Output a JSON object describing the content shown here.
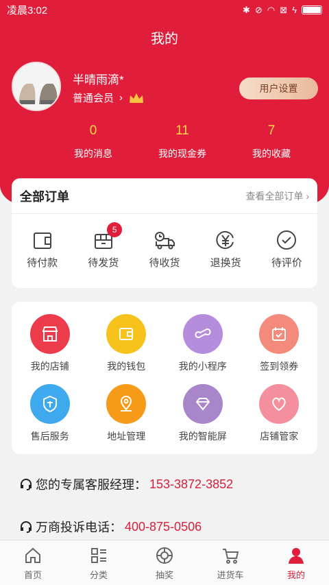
{
  "status_bar": {
    "time": "凌晨3:02"
  },
  "header": {
    "title": "我的"
  },
  "profile": {
    "username": "半晴雨滴*",
    "member_level": "普通会员",
    "settings_label": "用户设置"
  },
  "stats": [
    {
      "value": "0",
      "label": "我的消息"
    },
    {
      "value": "11",
      "label": "我的现金券"
    },
    {
      "value": "7",
      "label": "我的收藏"
    }
  ],
  "orders": {
    "title": "全部订单",
    "view_all": "查看全部订单 ›",
    "items": [
      {
        "label": "待付款",
        "icon": "wallet-icon"
      },
      {
        "label": "待发货",
        "icon": "box-icon",
        "badge": "5"
      },
      {
        "label": "待收货",
        "icon": "truck-icon"
      },
      {
        "label": "退换货",
        "icon": "yen-exchange-icon"
      },
      {
        "label": "待评价",
        "icon": "check-circle-icon"
      }
    ]
  },
  "services": [
    {
      "label": "我的店铺",
      "icon": "store-icon",
      "color": "#ec3b4b"
    },
    {
      "label": "我的钱包",
      "icon": "wallet-icon",
      "color": "#f8c21d"
    },
    {
      "label": "我的小程序",
      "icon": "link-icon",
      "color": "#b58ddc"
    },
    {
      "label": "签到领券",
      "icon": "calendar-check-icon",
      "color": "#f48a7c"
    },
    {
      "label": "售后服务",
      "icon": "shield-icon",
      "color": "#3ea9ec"
    },
    {
      "label": "地址管理",
      "icon": "location-icon",
      "color": "#f79a19"
    },
    {
      "label": "我的智能屏",
      "icon": "diamond-icon",
      "color": "#a986c9"
    },
    {
      "label": "店铺管家",
      "icon": "heart-icon",
      "color": "#f4909e"
    }
  ],
  "contacts": [
    {
      "label": "您的专属客服经理：",
      "phone": "153-3872-3852"
    },
    {
      "label": "万商投诉电话：",
      "phone": "400-875-0506"
    }
  ],
  "tabbar": [
    {
      "label": "首页",
      "icon": "home-icon"
    },
    {
      "label": "分类",
      "icon": "category-icon"
    },
    {
      "label": "抽奖",
      "icon": "lottery-icon"
    },
    {
      "label": "进货车",
      "icon": "cart-icon"
    },
    {
      "label": "我的",
      "icon": "user-icon",
      "active": true
    }
  ],
  "colors": {
    "brand": "#e01e3c",
    "accent_number": "#ffd84a"
  }
}
